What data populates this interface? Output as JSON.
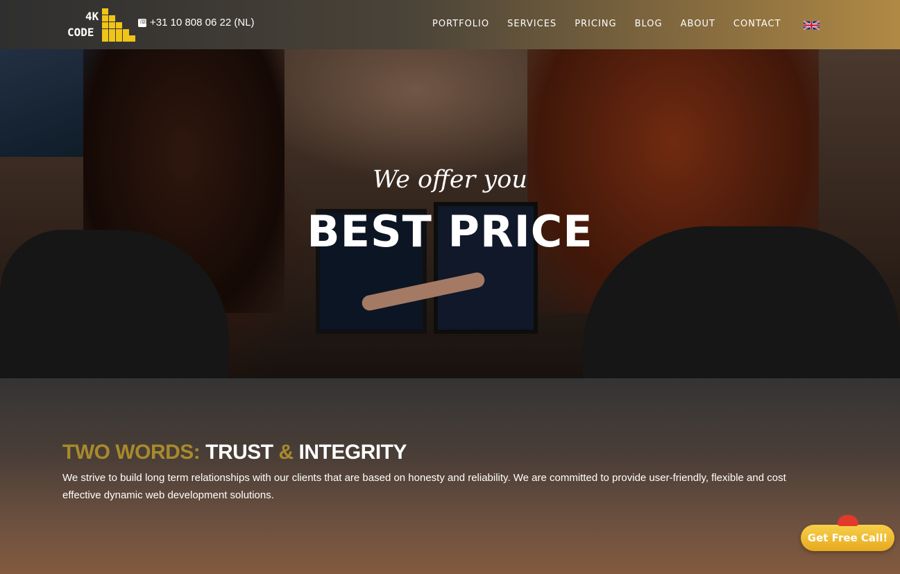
{
  "header": {
    "logo": {
      "line1": "4K",
      "line2": "CODE",
      "icon": "stacked-blocks-logo"
    },
    "phone": {
      "icon": "phone-icon",
      "number": "+31 10 808 06 22 (NL)"
    },
    "nav": [
      {
        "label": "PORTFOLIO"
      },
      {
        "label": "SERVICES"
      },
      {
        "label": "PRICING"
      },
      {
        "label": "BLOG"
      },
      {
        "label": "ABOUT"
      },
      {
        "label": "CONTACT"
      }
    ],
    "language": {
      "icon": "uk-flag-icon"
    }
  },
  "hero": {
    "subtitle": "We offer you",
    "title": "BEST PRICE"
  },
  "section": {
    "title_part1": "TWO WORDS:",
    "title_part2": "TRUST",
    "title_amp": "&",
    "title_part3": "INTEGRITY",
    "body": "We strive to build long term relationships with our clients that are based on honesty and reliability. We are committed to provide user-friendly, flexible and cost effective dynamic web development solutions."
  },
  "cta": {
    "label": "Get Free Call!",
    "icon": "telephone-icon"
  },
  "colors": {
    "accent_gold": "#a88a2c",
    "logo_yellow": "#f0c419",
    "cta_yellow": "#f0c419",
    "cta_icon_red": "#e03a2b"
  }
}
